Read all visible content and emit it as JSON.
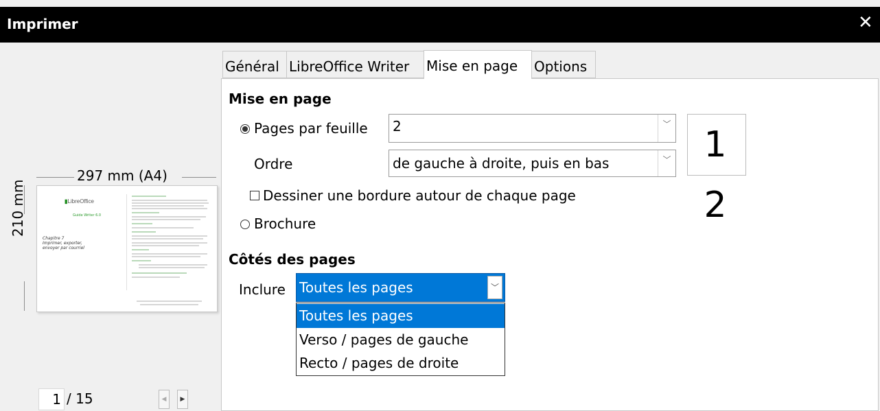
{
  "window": {
    "title": "Imprimer",
    "close_icon": "close-icon"
  },
  "preview": {
    "width_label": "297 mm (A4)",
    "height_label": "210 mm",
    "thumbnail": {
      "logo": "LibreOffice",
      "guide": "Guide Writer 6.0",
      "chapter": "Chapitre 7\nImprimer, exporter,\nenvoyer par courriel"
    },
    "page_current": "1",
    "page_total": "/ 15",
    "prev_icon": "triangle-left-icon",
    "next_icon": "triangle-right-icon"
  },
  "tabs": [
    {
      "label": "Général",
      "active": false
    },
    {
      "label": "LibreOffice Writer",
      "active": false
    },
    {
      "label": "Mise en page",
      "active": true
    },
    {
      "label": "Options",
      "active": false
    }
  ],
  "layout": {
    "section_title": "Mise en page",
    "pages_per_sheet_label": "Pages par feuille",
    "pages_per_sheet_value": "2",
    "pages_preview": "1 2",
    "order_label": "Ordre",
    "order_value": "de gauche à droite, puis en bas",
    "border_label": "Dessiner une bordure autour de chaque page",
    "brochure_label": "Brochure"
  },
  "sides": {
    "section_title": "Côtés des pages",
    "include_label": "Inclure",
    "include_value": "Toutes les pages",
    "options": [
      "Toutes les pages",
      "Verso / pages de gauche",
      "Recto / pages de droite"
    ]
  },
  "colors": {
    "accent": "#0078d7",
    "titlebar": "#000000"
  }
}
